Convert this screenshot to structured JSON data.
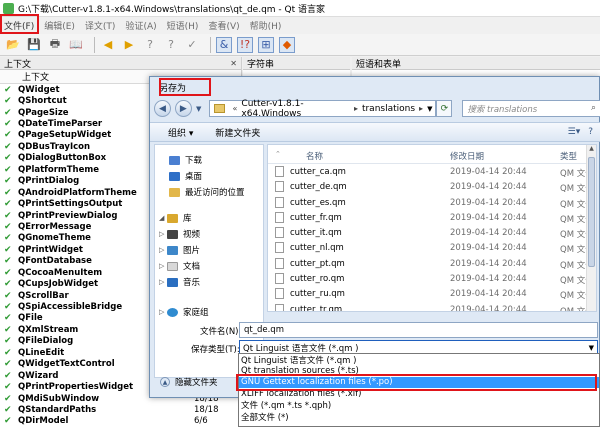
{
  "main_window": {
    "title": "G:\\下载\\Cutter-v1.8.1-x64.Windows\\translations\\qt_de.qm - Qt 语言家",
    "menu": [
      "文件(F)",
      "编辑(E)",
      "译文(T)",
      "验证(A)",
      "短语(H)",
      "查看(V)",
      "帮助(H)"
    ],
    "toolbar_icons": [
      "open-icon",
      "save-icon",
      "print-icon",
      "phrasebook-icon",
      "prev-icon",
      "next-icon",
      "prev-unfinished-icon",
      "next-unfinished-icon",
      "done-next-icon",
      "accelerators-icon",
      "punctuation-icon",
      "phrase-match-icon",
      "placeholder-icon"
    ]
  },
  "context_dock": {
    "title": "上下文",
    "column": "上下文",
    "items": [
      {
        "name": "QWidget",
        "count": ""
      },
      {
        "name": "QShortcut",
        "count": ""
      },
      {
        "name": "QPageSize",
        "count": ""
      },
      {
        "name": "QDateTimeParser",
        "count": ""
      },
      {
        "name": "QPageSetupWidget",
        "count": ""
      },
      {
        "name": "QDBusTrayIcon",
        "count": ""
      },
      {
        "name": "QDialogButtonBox",
        "count": ""
      },
      {
        "name": "QPlatformTheme",
        "count": ""
      },
      {
        "name": "QPrintDialog",
        "count": ""
      },
      {
        "name": "QAndroidPlatformTheme",
        "count": ""
      },
      {
        "name": "QPrintSettingsOutput",
        "count": ""
      },
      {
        "name": "QPrintPreviewDialog",
        "count": ""
      },
      {
        "name": "QErrorMessage",
        "count": ""
      },
      {
        "name": "QGnomeTheme",
        "count": ""
      },
      {
        "name": "QPrintWidget",
        "count": ""
      },
      {
        "name": "QFontDatabase",
        "count": ""
      },
      {
        "name": "QCocoaMenuItem",
        "count": ""
      },
      {
        "name": "QCupsJobWidget",
        "count": ""
      },
      {
        "name": "QScrollBar",
        "count": ""
      },
      {
        "name": "QSpiAccessibleBridge",
        "count": ""
      },
      {
        "name": "QFile",
        "count": ""
      },
      {
        "name": "QXmlStream",
        "count": ""
      },
      {
        "name": "QFileDialog",
        "count": ""
      },
      {
        "name": "QLineEdit",
        "count": ""
      },
      {
        "name": "QWidgetTextControl",
        "count": ""
      },
      {
        "name": "QWizard",
        "count": ""
      },
      {
        "name": "QPrintPropertiesWidget",
        "count": ""
      },
      {
        "name": "QMdiSubWindow",
        "count": "18/18"
      },
      {
        "name": "QStandardPaths",
        "count": "18/18"
      },
      {
        "name": "QDirModel",
        "count": "6/6"
      }
    ]
  },
  "strings_pane": {
    "title": "字符串"
  },
  "phrases_pane": {
    "title": "短语和表单"
  },
  "dialog": {
    "title": "另存为",
    "breadcrumb": [
      "Cutter-v1.8.1-x64.Windows",
      "translations"
    ],
    "search_placeholder": "搜索 translations",
    "organize_label": "组织 ▾",
    "new_folder_label": "新建文件夹",
    "nav": {
      "downloads": "下载",
      "desktop": "桌面",
      "recent": "最近访问的位置",
      "library": "库",
      "videos": "视频",
      "pictures": "图片",
      "documents": "文档",
      "music": "音乐",
      "homegroup": "家庭组"
    },
    "columns": {
      "name": "名称",
      "date": "修改日期",
      "type": "类型"
    },
    "files": [
      {
        "name": "cutter_ca.qm",
        "date": "2019-04-14 20:44",
        "type": "QM 文件"
      },
      {
        "name": "cutter_de.qm",
        "date": "2019-04-14 20:44",
        "type": "QM 文件"
      },
      {
        "name": "cutter_es.qm",
        "date": "2019-04-14 20:44",
        "type": "QM 文件"
      },
      {
        "name": "cutter_fr.qm",
        "date": "2019-04-14 20:44",
        "type": "QM 文件"
      },
      {
        "name": "cutter_it.qm",
        "date": "2019-04-14 20:44",
        "type": "QM 文件"
      },
      {
        "name": "cutter_nl.qm",
        "date": "2019-04-14 20:44",
        "type": "QM 文件"
      },
      {
        "name": "cutter_pt.qm",
        "date": "2019-04-14 20:44",
        "type": "QM 文件"
      },
      {
        "name": "cutter_ro.qm",
        "date": "2019-04-14 20:44",
        "type": "QM 文件"
      },
      {
        "name": "cutter_ru.qm",
        "date": "2019-04-14 20:44",
        "type": "QM 文件"
      },
      {
        "name": "cutter_tr.qm",
        "date": "2019-04-14 20:44",
        "type": "QM 文件"
      }
    ],
    "filename_label": "文件名(N):",
    "filename_value": "qt_de.qm",
    "savetype_label": "保存类型(T):",
    "savetype_value": "Qt Linguist 语言文件 (*.qm )",
    "hide_folders_label": "隐藏文件夹",
    "type_options": [
      {
        "label": "Qt Linguist 语言文件 (*.qm )",
        "selected": false
      },
      {
        "label": "Qt translation sources (*.ts)",
        "selected": false
      },
      {
        "label": "GNU Gettext localization files (*.po)",
        "selected": true
      },
      {
        "label": "XLIFF localization files (*.xlf)",
        "selected": false
      },
      {
        "label": "文件 (*.qm *.ts *.qph)",
        "selected": false
      },
      {
        "label": "全部文件 (*)",
        "selected": false
      }
    ]
  },
  "colors": {
    "annotation": "#e0151a",
    "selection": "#3399ff",
    "check": "#2e9a33"
  }
}
